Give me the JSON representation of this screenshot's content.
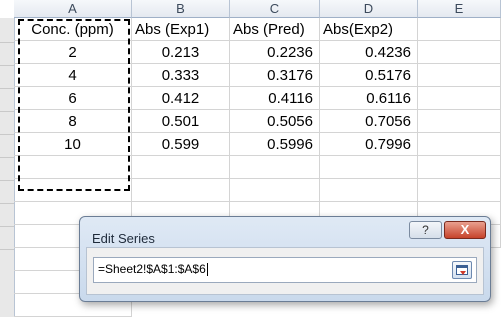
{
  "columns": [
    "A",
    "B",
    "C",
    "D",
    "E"
  ],
  "rows": [
    [
      "Conc. (ppm)",
      "Abs (Exp1)",
      "Abs (Pred)",
      "Abs(Exp2)",
      ""
    ],
    [
      "2",
      "0.213",
      "0.2236",
      "0.4236",
      ""
    ],
    [
      "4",
      "0.333",
      "0.3176",
      "0.5176",
      ""
    ],
    [
      "6",
      "0.412",
      "0.4116",
      "0.6116",
      ""
    ],
    [
      "8",
      "0.501",
      "0.5056",
      "0.7056",
      ""
    ],
    [
      "10",
      "0.599",
      "0.5996",
      "0.7996",
      ""
    ]
  ],
  "dialog": {
    "title": "Edit Series",
    "help_label": "?",
    "close_label": "X",
    "range_value": "=Sheet2!$A$1:$A$6"
  },
  "colors": {
    "selection_border": "#000000",
    "close_button": "#c7432b",
    "dialog_bg": "#dfe9f5"
  }
}
